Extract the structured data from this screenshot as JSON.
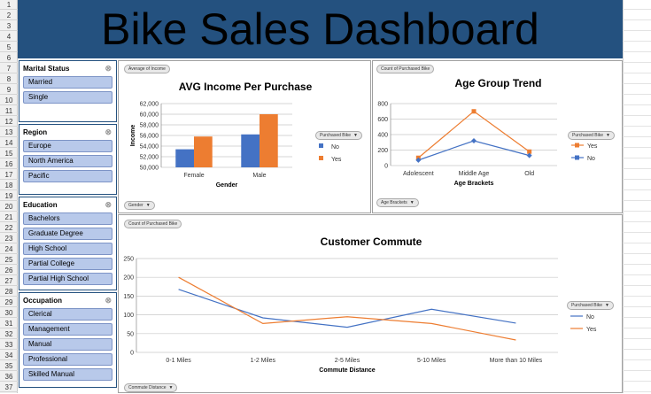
{
  "title": "Bike Sales Dashboard",
  "rows": [
    "1",
    "2",
    "3",
    "4",
    "5",
    "6",
    "7",
    "8",
    "9",
    "10",
    "11",
    "12",
    "13",
    "14",
    "15",
    "16",
    "17",
    "18",
    "19",
    "20",
    "21",
    "22",
    "23",
    "24",
    "25",
    "26",
    "27",
    "28",
    "29",
    "30",
    "31",
    "32",
    "33",
    "34",
    "35",
    "36",
    "37"
  ],
  "slicers": {
    "marital": {
      "title": "Marital Status",
      "items": [
        "Married",
        "Single"
      ]
    },
    "region": {
      "title": "Region",
      "items": [
        "Europe",
        "North America",
        "Pacific"
      ]
    },
    "education": {
      "title": "Education",
      "items": [
        "Bachelors",
        "Graduate Degree",
        "High School",
        "Partial College",
        "Partial High School"
      ]
    },
    "occupation": {
      "title": "Occupation",
      "items": [
        "Clerical",
        "Management",
        "Manual",
        "Professional",
        "Skilled Manual"
      ]
    }
  },
  "income_panel": {
    "field_button": "Average of Income",
    "axis_button": "Gender",
    "legend_button": "Purchased Bike"
  },
  "age_panel": {
    "field_button": "Count of Purchased Bike",
    "axis_button": "Age Brackets",
    "legend_button": "Purchased Bike"
  },
  "commute_panel": {
    "field_button": "Count of Purchased Bike",
    "axis_button": "Commute Distance",
    "legend_button": "Purchased Bike"
  },
  "chart_data": [
    {
      "type": "bar",
      "title": "AVG Income Per Purchase",
      "xlabel": "Gender",
      "ylabel": "Income",
      "categories": [
        "Female",
        "Male"
      ],
      "ylim": [
        50000,
        62000
      ],
      "yticks": [
        "50,000",
        "52,000",
        "54,000",
        "56,000",
        "58,000",
        "60,000",
        "62,000"
      ],
      "series": [
        {
          "name": "No",
          "color": "#4472c4",
          "values": [
            53400,
            56200
          ]
        },
        {
          "name": "Yes",
          "color": "#ed7d31",
          "values": [
            55800,
            60000
          ]
        }
      ],
      "legend": "right"
    },
    {
      "type": "line",
      "title": "Age Group Trend",
      "xlabel": "Age Brackets",
      "ylabel": "",
      "categories": [
        "Adolescent",
        "Middle Age",
        "Old"
      ],
      "ylim": [
        0,
        800
      ],
      "yticks": [
        "0",
        "200",
        "400",
        "600",
        "800"
      ],
      "series": [
        {
          "name": "Yes",
          "color": "#ed7d31",
          "values": [
            100,
            700,
            180
          ]
        },
        {
          "name": "No",
          "color": "#4472c4",
          "values": [
            70,
            320,
            130
          ]
        }
      ],
      "legend": "right"
    },
    {
      "type": "line",
      "title": "Customer Commute",
      "xlabel": "Commute Distance",
      "ylabel": "",
      "categories": [
        "0-1 Miles",
        "1-2 Miles",
        "2-5 Miles",
        "5-10 Miles",
        "More than 10 Miles"
      ],
      "ylim": [
        0,
        250
      ],
      "yticks": [
        "0",
        "50",
        "100",
        "150",
        "200",
        "250"
      ],
      "series": [
        {
          "name": "No",
          "color": "#4472c4",
          "values": [
            168,
            92,
            67,
            115,
            78
          ]
        },
        {
          "name": "Yes",
          "color": "#ed7d31",
          "values": [
            200,
            77,
            95,
            77,
            33
          ]
        }
      ],
      "legend": "right"
    }
  ]
}
